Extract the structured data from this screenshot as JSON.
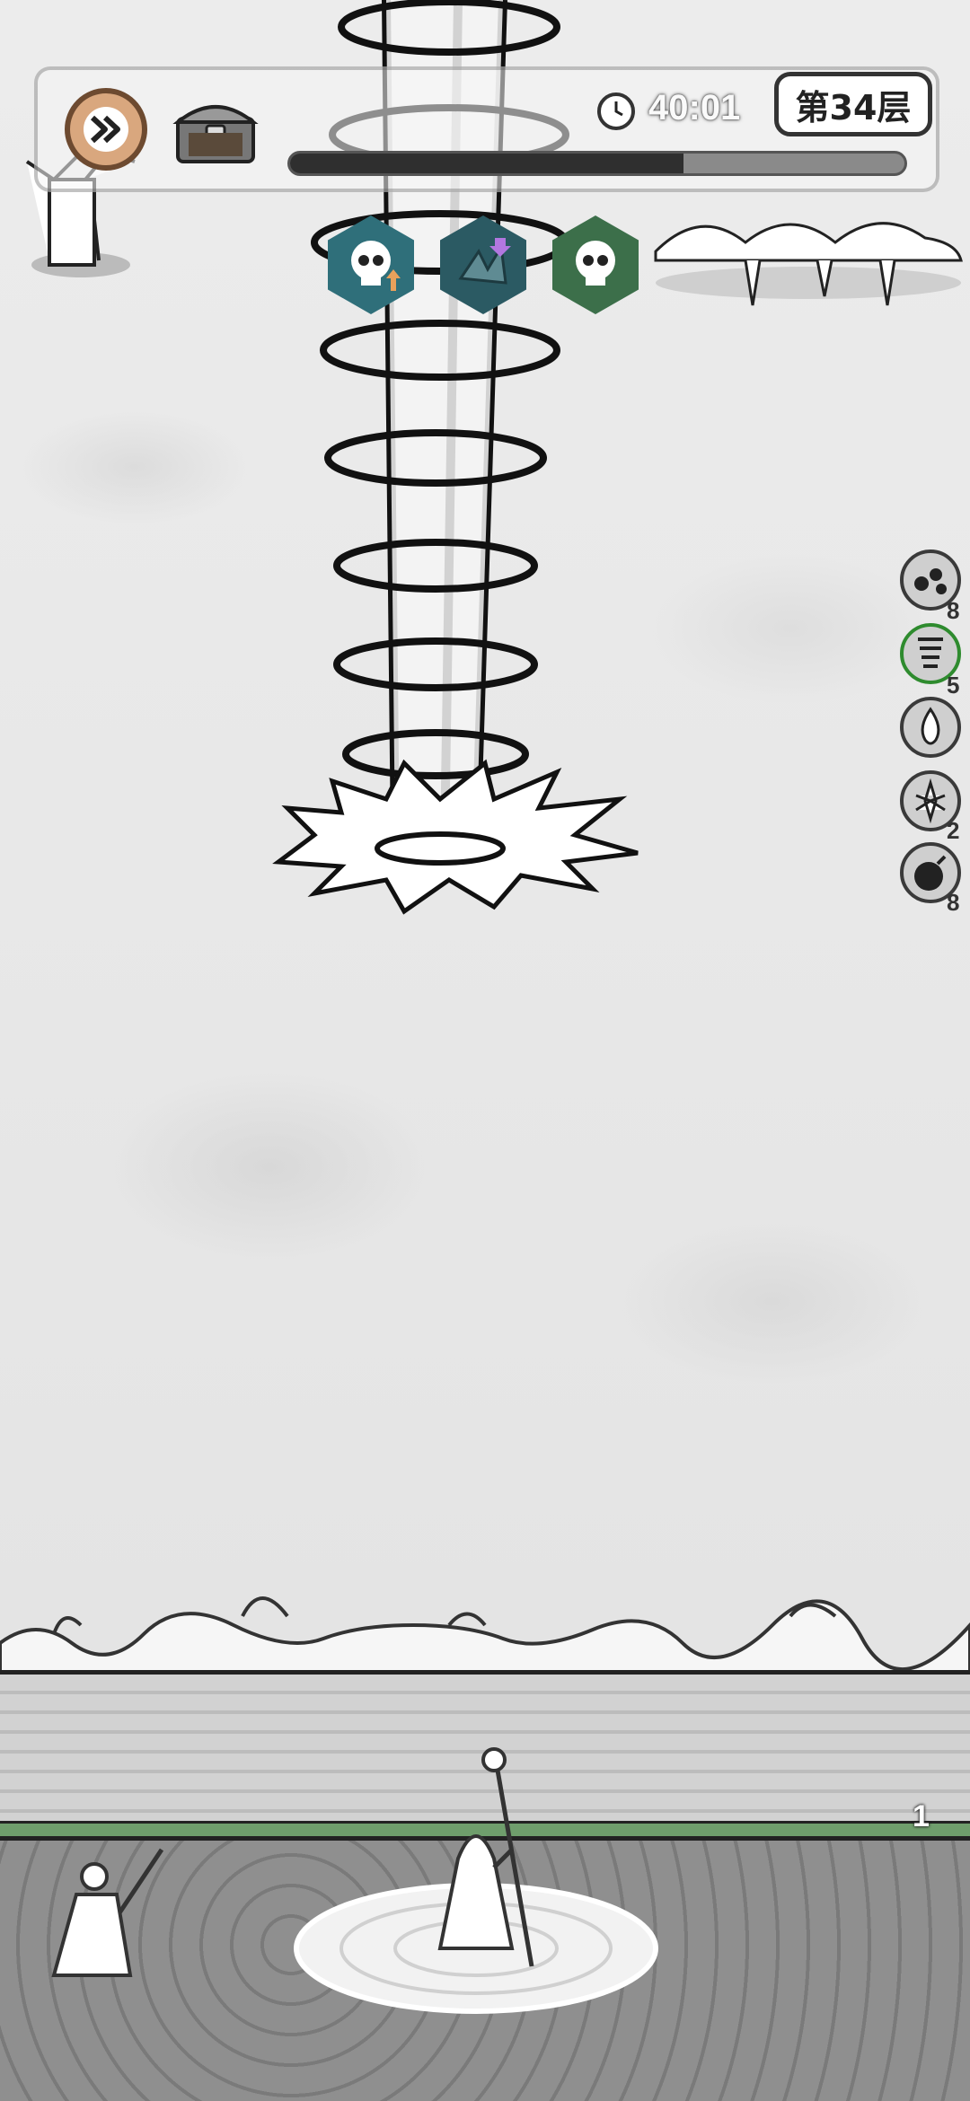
{
  "hud": {
    "timer": "40:01",
    "floor": "第34层",
    "progress": 0.64
  },
  "buffs": [
    {
      "name": "skull-attack-up",
      "arrow": "up"
    },
    {
      "name": "shard-armor-down",
      "arrow": "down"
    },
    {
      "name": "skull",
      "arrow": ""
    }
  ],
  "skills": [
    {
      "name": "dark-drops",
      "count": "8"
    },
    {
      "name": "tornado",
      "count": "5"
    },
    {
      "name": "ghost-fire",
      "count": ""
    },
    {
      "name": "ice-crystal",
      "count": "2"
    },
    {
      "name": "bomb",
      "count": "8"
    }
  ],
  "wall": {
    "level": "1",
    "hp": 1.0
  },
  "colors": {
    "fast_forward": "#d9a77e",
    "hp_bar": "#6f9e6c",
    "buff_hex": "#2f6f7a"
  }
}
